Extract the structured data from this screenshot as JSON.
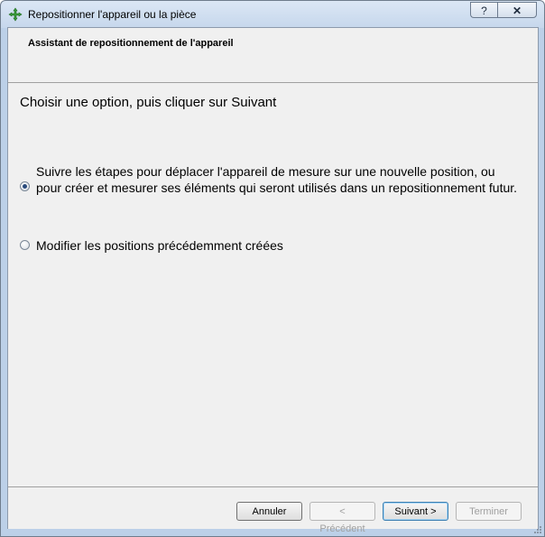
{
  "window": {
    "title": "Repositionner l'appareil ou la pièce",
    "help_glyph": "?",
    "close_glyph": "✕"
  },
  "header": {
    "title": "Assistant de repositionnement de l'appareil"
  },
  "main": {
    "instruction": "Choisir une option, puis cliquer sur Suivant",
    "options": [
      {
        "label": "Suivre les étapes pour déplacer l'appareil de mesure sur une nouvelle position, ou pour créer et mesurer ses éléments qui seront utilisés dans un repositionnement futur.",
        "selected": true
      },
      {
        "label": "Modifier les positions précédemment créées",
        "selected": false
      }
    ]
  },
  "footer": {
    "cancel_label": "Annuler",
    "previous_label": "< Précédent",
    "next_label": "Suivant >",
    "finish_label": "Terminer"
  }
}
